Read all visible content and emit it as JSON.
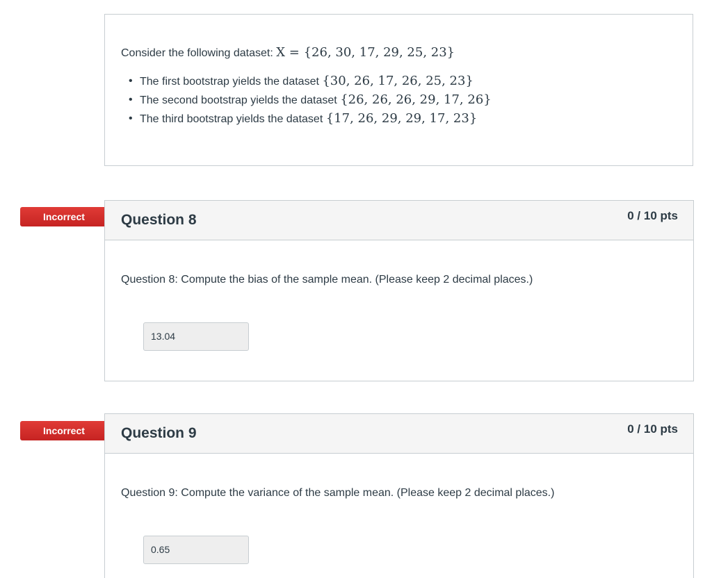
{
  "intro": {
    "lead": "Consider the following dataset: ",
    "dataset_math": "X = {26, 30, 17, 29, 25, 23}",
    "bullets": [
      {
        "text": "The first bootstrap yields the dataset ",
        "math": "{30, 26, 17, 26, 25, 23}"
      },
      {
        "text": "The second bootstrap yields the dataset ",
        "math": "{26, 26, 26, 29, 17, 26}"
      },
      {
        "text": "The third bootstrap yields the dataset ",
        "math": "{17, 26, 29, 29, 17, 23}"
      }
    ]
  },
  "questions": [
    {
      "status": "Incorrect",
      "title": "Question 8",
      "points": "0 / 10 pts",
      "text": "Question 8: Compute the bias of the sample mean. (Please keep 2 decimal places.)",
      "answer": "13.04"
    },
    {
      "status": "Incorrect",
      "title": "Question 9",
      "points": "0 / 10 pts",
      "text": "Question 9: Compute the variance of the sample mean. (Please keep 2 decimal places.)",
      "answer": "0.65"
    }
  ],
  "colors": {
    "incorrect_tag": "#d22c2c",
    "header_bg": "#f5f5f5",
    "border": "#c7cdd1",
    "text": "#2d3b45"
  }
}
